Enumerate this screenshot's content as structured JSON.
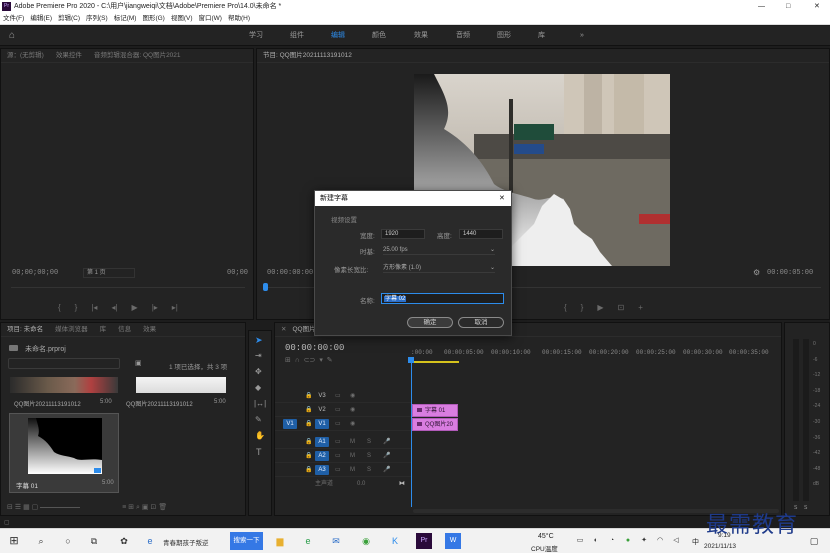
{
  "titlebar": {
    "title": "Adobe Premiere Pro 2020 - C:\\用户\\jiangweiqi\\文档\\Adobe\\Premiere Pro\\14.0\\未命名 *",
    "minimize": "—",
    "maximize": "□",
    "close": "✕"
  },
  "menubar": {
    "items": [
      "文件(F)",
      "编辑(E)",
      "剪辑(C)",
      "序列(S)",
      "标记(M)",
      "图形(G)",
      "视图(V)",
      "窗口(W)",
      "帮助(H)"
    ]
  },
  "workspaces": {
    "items": [
      "学习",
      "组件",
      "编辑",
      "颜色",
      "效果",
      "音频",
      "图形",
      "库"
    ],
    "active": "编辑",
    "more": "»"
  },
  "source_panel": {
    "tabs": [
      "源：(无剪辑)",
      "效果控件",
      "音频剪辑混合器: QQ图片2021"
    ],
    "timecode_left": "00;00;00;00",
    "page_label": "第 1 页",
    "timecode_right": "00;00"
  },
  "program_panel": {
    "tab": "节目: QQ图片20211113191012",
    "timecode_left": "00:00:00:00",
    "timecode_right": "00:00:05:00"
  },
  "project_panel": {
    "tabs": [
      "项目: 未命名",
      "媒体浏览器",
      "库",
      "信息",
      "效果"
    ],
    "project_file": "未命名.prproj",
    "selection_info": "1 项已选择，共 3 项",
    "items": [
      {
        "name": "QQ图片20211113191012",
        "duration": "5:00"
      },
      {
        "name": "QQ图片20211113191012",
        "duration": "5:00"
      },
      {
        "name": "字幕 01",
        "duration": "5:00"
      }
    ]
  },
  "timeline": {
    "tab": "QQ图片",
    "timecode": "00:00:00:00",
    "ruler": [
      ":00:00",
      "00:00:05:00",
      "00:00:10:00",
      "00:00:15:00",
      "00:00:20:00",
      "00:00:25:00",
      "00:00:30:00",
      "00:00:35:00"
    ],
    "video_tracks": [
      "V3",
      "V2",
      "V1"
    ],
    "audio_tracks": [
      "A1",
      "A2",
      "A3"
    ],
    "master": "主声道",
    "master_value": "0.0",
    "source_patch_v": "V1",
    "clips": [
      {
        "label": "字幕 01",
        "track": "V2"
      },
      {
        "label": "QQ图片20",
        "track": "V1"
      }
    ]
  },
  "dialog": {
    "title": "新建字幕",
    "section": "视频设置",
    "width_label": "宽度:",
    "width": "1920",
    "height_label": "高度:",
    "height": "1440",
    "timebase_label": "时基:",
    "timebase": "25.00 fps",
    "par_label": "像素长宽比:",
    "par": "方形像素 (1.0)",
    "name_label": "名称:",
    "name": "字幕 02",
    "ok": "确定",
    "cancel": "取消",
    "close": "✕"
  },
  "audio_meter": {
    "labels": [
      "0",
      "-6",
      "-12",
      "-18",
      "-24",
      "-30",
      "-36",
      "-42",
      "-48",
      "dB"
    ],
    "solo": "S",
    "solo2": "S"
  },
  "taskbar": {
    "search_tab": "青春期孩子叛逆",
    "baidu": "搜索一下",
    "weather_temp": "45°C",
    "weather_label": "CPU温度",
    "ime": "中",
    "time": "9:19",
    "date": "2021/11/13",
    "watermark": "最需教育"
  },
  "colors": {
    "accent": "#2d8ceb",
    "clip": "#d97de0",
    "track_active": "#1f5fa6"
  }
}
